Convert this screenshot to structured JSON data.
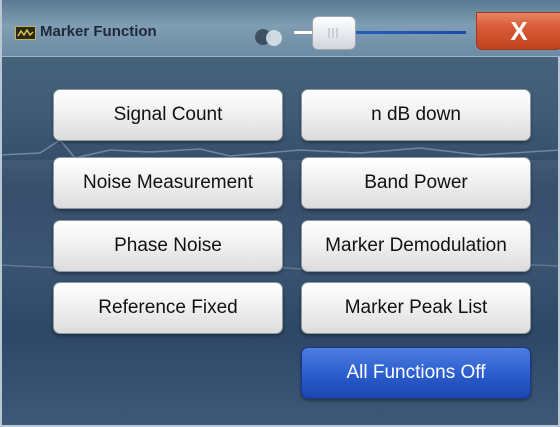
{
  "dialog": {
    "title": "Marker Function",
    "close_label": "X",
    "transparency_slider": {
      "value": 0.14
    }
  },
  "buttons": {
    "left": [
      "Signal Count",
      "Noise Measurement",
      "Phase Noise",
      "Reference Fixed"
    ],
    "right": [
      "n dB down",
      "Band Power",
      "Marker Demodulation",
      "Marker Peak List",
      "All Functions Off"
    ]
  },
  "colors": {
    "close_button": "#d85a36",
    "selected_button": "#2c5fd0",
    "button_face": "#f1f1f1"
  }
}
